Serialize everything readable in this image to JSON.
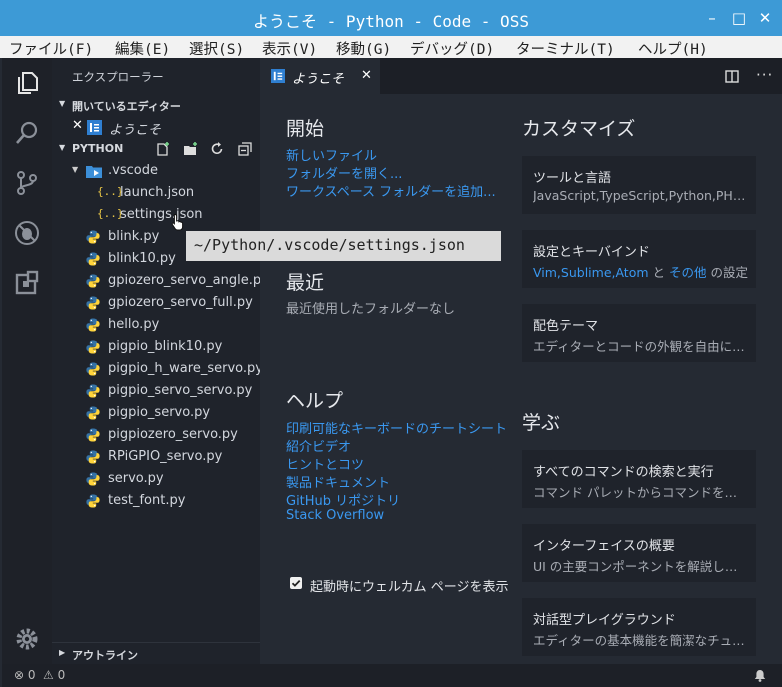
{
  "window": {
    "title": "ようこそ - Python - Code - OSS",
    "controls": [
      "minimize-icon",
      "maximize-icon",
      "close-icon"
    ]
  },
  "menu": [
    "ファイル(F)",
    "編集(E)",
    "選択(S)",
    "表示(V)",
    "移動(G)",
    "デバッグ(D)",
    "ターミナル(T)",
    "ヘルプ(H)"
  ],
  "sidebar": {
    "header": "エクスプローラー",
    "open_editors_label": "開いているエディター",
    "open_editor_item": "ようこそ",
    "folder_label": "PYTHON",
    "folder": ".vscode",
    "json_files": [
      "launch.json",
      "settings.json"
    ],
    "py_files": [
      "blink.py",
      "blink10.py",
      "gpiozero_servo_angle.py",
      "gpiozero_servo_full.py",
      "hello.py",
      "pigpio_blink10.py",
      "pigpio_h_ware_servo.py",
      "pigpio_servo_servo.py",
      "pigpio_servo.py",
      "pigpiozero_servo.py",
      "RPiGPIO_servo.py",
      "servo.py",
      "test_font.py"
    ],
    "outline_label": "アウトライン"
  },
  "tooltip": "~/Python/.vscode/settings.json",
  "tab": {
    "label": "ようこそ"
  },
  "welcome": {
    "start_title": "開始",
    "start_links": [
      "新しいファイル",
      "フォルダーを開く...",
      "ワークスペース フォルダーを追加..."
    ],
    "recent_title": "最近",
    "recent_none": "最近使用したフォルダーなし",
    "help_title": "ヘルプ",
    "help_links": [
      "印刷可能なキーボードのチートシート",
      "紹介ビデオ",
      "ヒントとコツ",
      "製品ドキュメント",
      "GitHub リポジトリ",
      "Stack Overflow"
    ],
    "show_on_startup": "起動時にウェルカム ページを表示",
    "customize_title": "カスタマイズ",
    "learn_title": "学ぶ",
    "cards": [
      {
        "title": "ツールと言語",
        "desc": "JavaScript,TypeScript,Python,PHP,Azure,Docker"
      },
      {
        "title": "設定とキーバインド",
        "desc_a": "Vim,Sublime,Atom",
        "desc_b": " と ",
        "desc_c": "その他",
        "desc_d": " の設定"
      },
      {
        "title": "配色テーマ",
        "desc": "エディターとコードの外観を自由に設定します"
      },
      {
        "title": "すべてのコマンドの検索と実行",
        "desc": "コマンド パレットからコマンドを検索"
      },
      {
        "title": "インターフェイスの概要",
        "desc": "UI の主要コンポーネントを解説します"
      },
      {
        "title": "対話型プレイグラウンド",
        "desc": "エディターの基本機能を簡潔なチュートリアル"
      }
    ]
  },
  "status": {
    "errors": "0",
    "warnings": "0"
  },
  "colors": {
    "accent": "#3d9ad6",
    "link": "#3a98f0"
  }
}
